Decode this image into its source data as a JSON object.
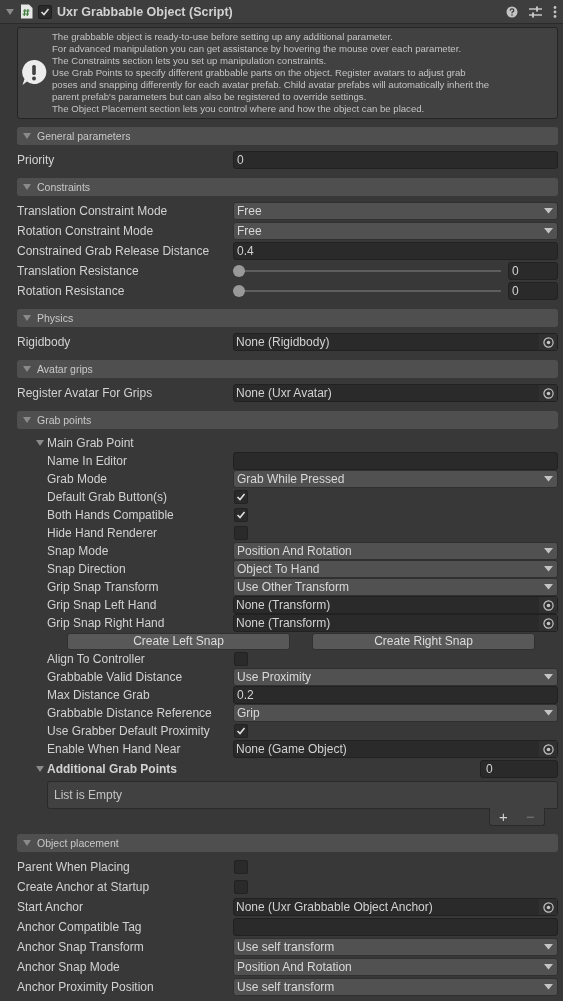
{
  "component": {
    "title": "Uxr Grabbable Object (Script)",
    "enabled": true,
    "expanded": true
  },
  "help_lines": [
    "The grabbable object is ready-to-use before setting up any additional parameter.",
    "For advanced manipulation you can get assistance by hovering the mouse over each parameter.",
    "The Constraints section lets you set up manipulation constraints.",
    "Use Grab Points to specify different grabbable parts on the object. Register avatars to adjust grab",
    "poses and snapping differently for each avatar prefab. Child avatar prefabs will automatically inherit the",
    "parent prefab's parameters but can also be registered to override settings.",
    "The Object Placement section lets you control where and how the object can be placed."
  ],
  "sections": [
    {
      "title": "General parameters",
      "expanded": true,
      "fields": [
        {
          "kind": "number",
          "label": "Priority",
          "value": "0"
        }
      ]
    },
    {
      "title": "Constraints",
      "expanded": true,
      "fields": [
        {
          "kind": "dropdown",
          "label": "Translation Constraint Mode",
          "value": "Free"
        },
        {
          "kind": "dropdown",
          "label": "Rotation Constraint Mode",
          "value": "Free"
        },
        {
          "kind": "number",
          "label": "Constrained Grab Release Distance",
          "value": "0.4"
        },
        {
          "kind": "slider",
          "label": "Translation Resistance",
          "level": 0,
          "value": "0"
        },
        {
          "kind": "slider",
          "label": "Rotation Resistance",
          "level": 0,
          "value": "0"
        }
      ]
    },
    {
      "title": "Physics",
      "expanded": true,
      "fields": [
        {
          "kind": "object",
          "label": "Rigidbody",
          "value": "None (Rigidbody)"
        }
      ]
    },
    {
      "title": "Avatar grips",
      "expanded": true,
      "fields": [
        {
          "kind": "object",
          "label": "Register Avatar For Grips",
          "value": "None (Uxr Avatar)"
        }
      ]
    },
    {
      "title": "Grab points",
      "expanded": true,
      "fields": [
        {
          "kind": "group",
          "label": "Main Grab Point",
          "expanded": true,
          "children": [
            {
              "kind": "text",
              "label": "Name In Editor"
            },
            {
              "kind": "dropdown",
              "label": "Grab Mode",
              "value": "Grab While Pressed"
            },
            {
              "kind": "checkbox",
              "label": "Default Grab Button(s)",
              "checked": true
            },
            {
              "kind": "checkbox",
              "label": "Both Hands Compatible",
              "checked": true
            },
            {
              "kind": "checkbox",
              "label": "Hide Hand Renderer",
              "checked": false
            },
            {
              "kind": "dropdown",
              "label": "Snap Mode",
              "value": "Position And Rotation"
            },
            {
              "kind": "dropdown",
              "label": "Snap Direction",
              "value": "Object To Hand"
            },
            {
              "kind": "dropdown",
              "label": "Grip Snap Transform",
              "value": "Use Other Transform"
            },
            {
              "kind": "object",
              "label": "Grip Snap Left Hand",
              "value": "None (Transform)"
            },
            {
              "kind": "object",
              "label": "Grip Snap Right Hand",
              "value": "None (Transform)"
            },
            {
              "kind": "buttons",
              "buttons": [
                "Create Left Snap",
                "Create Right Snap"
              ]
            },
            {
              "kind": "checkbox",
              "label": "Align To Controller",
              "checked": false
            },
            {
              "kind": "dropdown",
              "label": "Grabbable Valid Distance",
              "value": "Use Proximity"
            },
            {
              "kind": "number",
              "label": "Max Distance Grab",
              "value": "0.2"
            },
            {
              "kind": "dropdown",
              "label": "Grabbable Distance Reference",
              "value": "Grip"
            },
            {
              "kind": "checkbox",
              "label": "Use Grabber Default Proximity",
              "checked": true
            },
            {
              "kind": "object",
              "label": "Enable When Hand Near",
              "value": "None (Game Object)"
            }
          ]
        },
        {
          "kind": "list",
          "label": "Additional Grab Points",
          "expanded": true,
          "count": "0",
          "empty_text": "List is Empty",
          "add_button": "+",
          "remove_button": "−"
        }
      ]
    },
    {
      "title": "Object placement",
      "expanded": true,
      "fields": [
        {
          "kind": "checkbox",
          "label": "Parent When Placing",
          "checked": false
        },
        {
          "kind": "checkbox",
          "label": "Create Anchor at Startup",
          "checked": false
        },
        {
          "kind": "object",
          "label": "Start Anchor",
          "value": "None (Uxr Grabbable Object Anchor)"
        },
        {
          "kind": "text",
          "label": "Anchor Compatible Tag"
        },
        {
          "kind": "dropdown",
          "label": "Anchor Snap Transform",
          "value": "Use self transform"
        },
        {
          "kind": "dropdown",
          "label": "Anchor Snap Mode",
          "value": "Position And Rotation"
        },
        {
          "kind": "dropdown",
          "label": "Anchor Proximity Position",
          "value": "Use self transform"
        }
      ]
    }
  ]
}
